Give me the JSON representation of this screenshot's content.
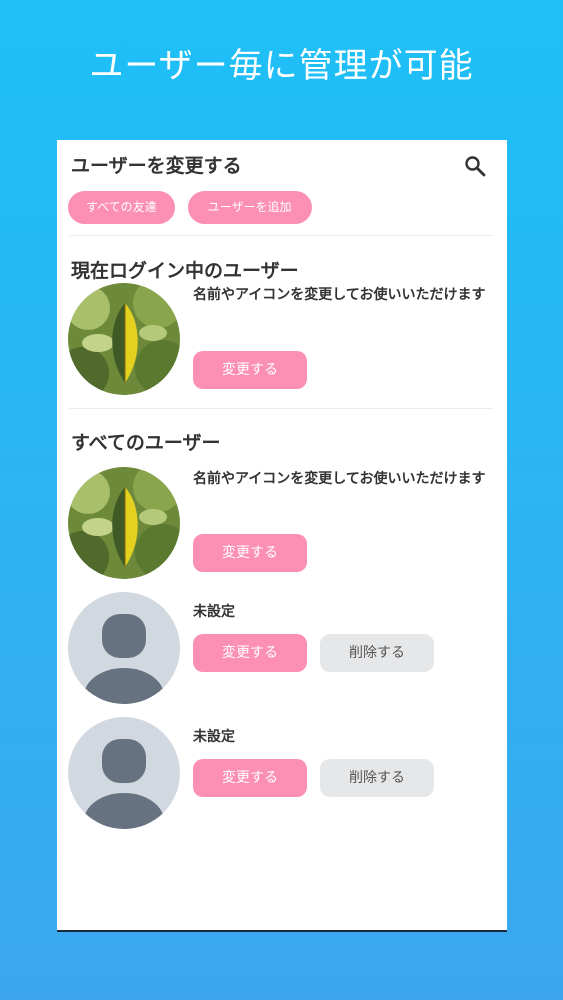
{
  "promo": {
    "title": "ユーザー毎に管理が可能"
  },
  "header": {
    "title": "ユーザーを変更する",
    "search_icon": "search-icon"
  },
  "chips": {
    "all_friends": "すべての友達",
    "add_user": "ユーザーを追加"
  },
  "current_section": {
    "title": "現在ログイン中のユーザー",
    "user": {
      "description": "名前やアイコンを変更してお使いいただけます",
      "change_label": "変更する"
    }
  },
  "all_section": {
    "title": "すべてのユーザー",
    "users": [
      {
        "description": "名前やアイコンを変更してお使いいただけます",
        "change_label": "変更する"
      },
      {
        "name": "未設定",
        "change_label": "変更する",
        "delete_label": "削除する"
      },
      {
        "name": "未設定",
        "change_label": "変更する",
        "delete_label": "削除する"
      }
    ]
  },
  "colors": {
    "accent_pink": "#fc8fb4",
    "background_blue": "#22bbf6",
    "button_gray": "#e6e7e9"
  }
}
